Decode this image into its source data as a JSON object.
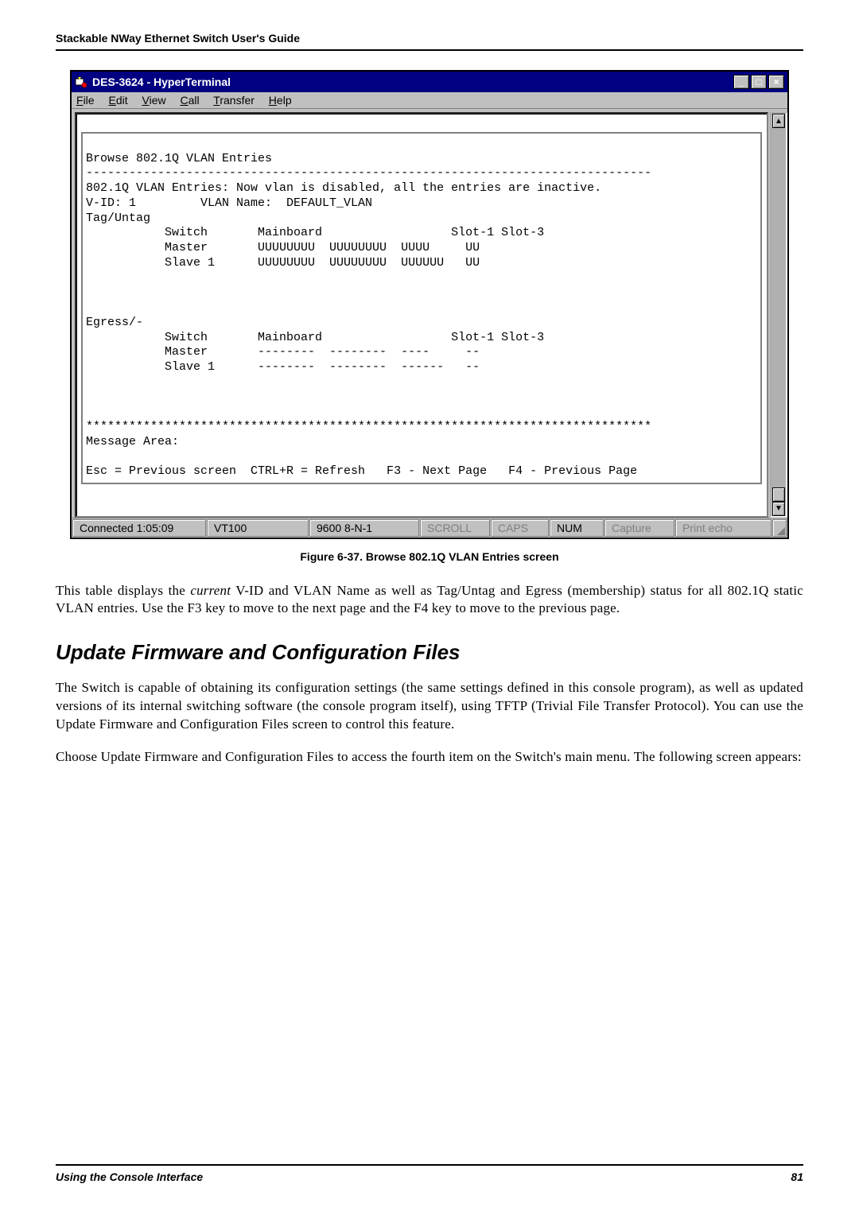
{
  "header": {
    "title": "Stackable NWay Ethernet Switch User's Guide"
  },
  "window": {
    "title": "DES-3624 - HyperTerminal",
    "menu": {
      "file": "File",
      "edit": "Edit",
      "view": "View",
      "call": "Call",
      "transfer": "Transfer",
      "help": "Help"
    },
    "terminal": {
      "screen_title": "Browse 802.1Q VLAN Entries",
      "divider": "-------------------------------------------------------------------------------",
      "status_line": "802.1Q VLAN Entries: Now vlan is disabled, all the entries are inactive.",
      "vid_line": "V-ID: 1         VLAN Name:  DEFAULT_VLAN",
      "tag_untag_label": "Tag/Untag",
      "cols_line1": "           Switch       Mainboard                  Slot-1 Slot-3",
      "tag_master": "           Master       UUUUUUUU  UUUUUUUU  UUUU     UU",
      "tag_slave": "           Slave 1      UUUUUUUU  UUUUUUUU  UUUUUU   UU",
      "egress_label": "Egress/-",
      "cols_line2": "           Switch       Mainboard                  Slot-1 Slot-3",
      "eg_master": "           Master       --------  --------  ----     --",
      "eg_slave": "           Slave 1      --------  --------  ------   --",
      "stars": "*******************************************************************************",
      "message_area": "Message Area:",
      "help_line": "Esc = Previous screen  CTRL+R = Refresh   F3 - Next Page   F4 - Previous Page"
    },
    "status": {
      "connected": "Connected 1:05:09",
      "emulation": "VT100",
      "settings": "9600 8-N-1",
      "scroll": "SCROLL",
      "caps": "CAPS",
      "num": "NUM",
      "capture": "Capture",
      "printecho": "Print echo"
    }
  },
  "figure_caption": "Figure 6-37.  Browse 802.1Q VLAN Entries screen",
  "para1_pre": "This table displays the ",
  "para1_ital": "current",
  "para1_post": " V-ID and VLAN Name as well as Tag/Untag and Egress (membership) status for all 802.1Q static VLAN entries.  Use the F3 key to move to the next page and the F4 key to move to the previous page.",
  "section_heading": "Update Firmware and Configuration Files",
  "para2": "The Switch is capable of obtaining its configuration settings (the same settings defined in this console program), as well as updated versions of its internal switching software (the console program itself), using TFTP (Trivial File Transfer Protocol). You can use the Update Firmware and Configuration Files screen to control this feature.",
  "para3": "Choose Update Firmware and Configuration Files to access the fourth item on the Switch's main menu. The following screen appears:",
  "footer": {
    "left": "Using the Console Interface",
    "right": "81"
  }
}
